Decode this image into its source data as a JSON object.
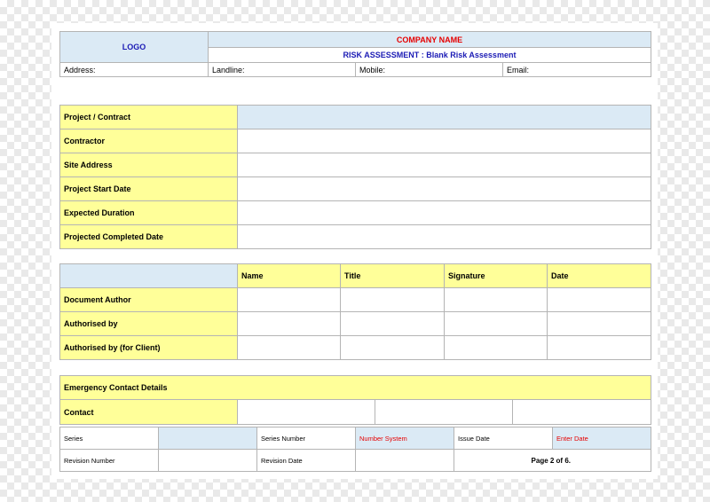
{
  "header": {
    "logo": "LOGO",
    "company_name": "COMPANY NAME",
    "subtitle": "RISK ASSESSMENT : Blank Risk Assessment",
    "address_label": "Address:",
    "landline_label": "Landline:",
    "mobile_label": "Mobile:",
    "email_label": "Email:"
  },
  "project": {
    "rows": [
      {
        "label": "Project / Contract"
      },
      {
        "label": "Contractor"
      },
      {
        "label": "Site Address"
      },
      {
        "label": "Project Start Date"
      },
      {
        "label": "Expected Duration"
      },
      {
        "label": "Projected Completed Date"
      }
    ]
  },
  "signoff": {
    "columns": [
      "Name",
      "Title",
      "Signature",
      "Date"
    ],
    "rows": [
      {
        "label": "Document Author"
      },
      {
        "label": "Authorised by"
      },
      {
        "label": "Authorised by (for Client)"
      }
    ]
  },
  "emergency": {
    "title": "Emergency Contact Details",
    "contact_label": "Contact"
  },
  "footer": {
    "series": "Series",
    "series_number": "Series Number",
    "number_system": "Number System",
    "issue_date": "Issue Date",
    "enter_date": "Enter Date",
    "revision_number": "Revision Number",
    "revision_date": "Revision Date",
    "page": "Page 2 of 6."
  },
  "colors": {
    "label_fill": "#ffff99",
    "header_fill": "#dbeaf5",
    "company_red": "#e60000",
    "subtitle_navy": "#1b1bb5"
  }
}
